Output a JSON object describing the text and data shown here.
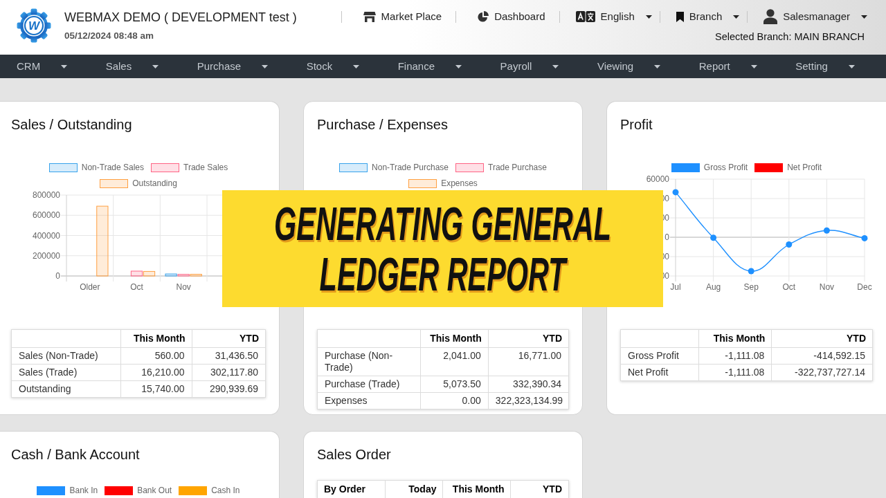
{
  "header": {
    "logo_letter": "W",
    "title": "WEBMAX DEMO ( DEVELOPMENT test )",
    "datetime": "05/12/2024 08:48 am",
    "nav": [
      {
        "kind": "link",
        "label": "Market Place"
      },
      {
        "kind": "link",
        "label": "Dashboard"
      },
      {
        "kind": "dropdown",
        "label": "English"
      },
      {
        "kind": "dropdown",
        "label": "Branch"
      },
      {
        "kind": "dropdown",
        "label": "Salesmanager"
      }
    ],
    "selected_branch": "Selected Branch: MAIN BRANCH"
  },
  "menu": [
    "CRM",
    "Sales",
    "Purchase",
    "Stock",
    "Finance",
    "Payroll",
    "Viewing",
    "Report",
    "Setting"
  ],
  "cards": [
    {
      "title": "Sales / Outstanding",
      "chart_data": {
        "type": "bar",
        "legend": "top",
        "grid": true,
        "categories": [
          "Older",
          "Oct",
          "Nov"
        ],
        "ylim": [
          0,
          800000
        ],
        "yticks": [
          0,
          200000,
          400000,
          600000,
          800000
        ],
        "series": [
          {
            "name": "Non-Trade Sales",
            "color": "#36a2eb",
            "values": [
              null,
              null,
              20000
            ]
          },
          {
            "name": "Trade Sales",
            "color": "#ff6384",
            "values": [
              null,
              48000,
              16000
            ]
          },
          {
            "name": "Outstanding",
            "color": "#ff9f40",
            "values": [
              690000,
              45000,
              17000
            ]
          }
        ]
      },
      "table": {
        "columns": [
          "This Month",
          "YTD"
        ],
        "rows": [
          {
            "label": "Sales (Non-Trade)",
            "values": [
              "560.00",
              "31,436.50"
            ]
          },
          {
            "label": "Sales (Trade)",
            "values": [
              "16,210.00",
              "302,117.80"
            ]
          },
          {
            "label": "Outstanding",
            "values": [
              "15,740.00",
              "290,939.69"
            ]
          }
        ]
      }
    },
    {
      "title": "Purchase / Expenses",
      "legend": {
        "tinted": true,
        "items": [
          {
            "label": "Non-Trade Purchase",
            "color": "#36a2eb"
          },
          {
            "label": "Trade Purchase",
            "color": "#ff6384"
          },
          {
            "label": "Expenses",
            "color": "#ff9f40"
          }
        ]
      },
      "table": {
        "columns": [
          "This Month",
          "YTD"
        ],
        "rows": [
          {
            "label": "Purchase (Non-Trade)",
            "values": [
              "2,041.00",
              "16,771.00"
            ]
          },
          {
            "label": "Purchase (Trade)",
            "values": [
              "5,073.50",
              "332,390.34"
            ]
          },
          {
            "label": "Expenses",
            "values": [
              "0.00",
              "322,323,134.99"
            ]
          }
        ]
      }
    },
    {
      "title": "Profit",
      "chart_data": {
        "type": "line",
        "legend": "top",
        "grid": true,
        "categories": [
          "Jul",
          "Aug",
          "Sep",
          "Oct",
          "Nov",
          "Dec"
        ],
        "ylim": [
          -40000,
          60000
        ],
        "yticks": [
          -40000,
          -20000,
          0,
          20000,
          40000,
          60000
        ],
        "series": [
          {
            "name": "Gross Profit",
            "color": "#1e90ff",
            "marker": "circle",
            "values": [
              46500,
              -500,
              -35000,
              -7500,
              7000,
              -1000
            ]
          },
          {
            "name": "Net Profit",
            "color": "#ff0000",
            "values": [
              null,
              null,
              null,
              null,
              null,
              null
            ]
          }
        ]
      },
      "table": {
        "columns": [
          "This Month",
          "YTD"
        ],
        "rows": [
          {
            "label": "Gross Profit",
            "values": [
              "-1,111.08",
              "-414,592.15"
            ]
          },
          {
            "label": "Net Profit",
            "values": [
              "-1,111.08",
              "-322,737,727.14"
            ]
          }
        ]
      }
    },
    {
      "title": "Cash / Bank Account",
      "legend": {
        "tinted": false,
        "items": [
          {
            "label": "Bank In",
            "color": "#1e90ff"
          },
          {
            "label": "Bank Out",
            "color": "#ff0000"
          },
          {
            "label": "Cash In",
            "color": "#ffa500"
          }
        ]
      }
    },
    {
      "title": "Sales Order",
      "table": {
        "columns": [
          "By Order",
          "Today",
          "This Month",
          "YTD"
        ]
      }
    }
  ],
  "overlay_banner": {
    "text": "GENERATING GENERAL LEDGER REPORT"
  }
}
